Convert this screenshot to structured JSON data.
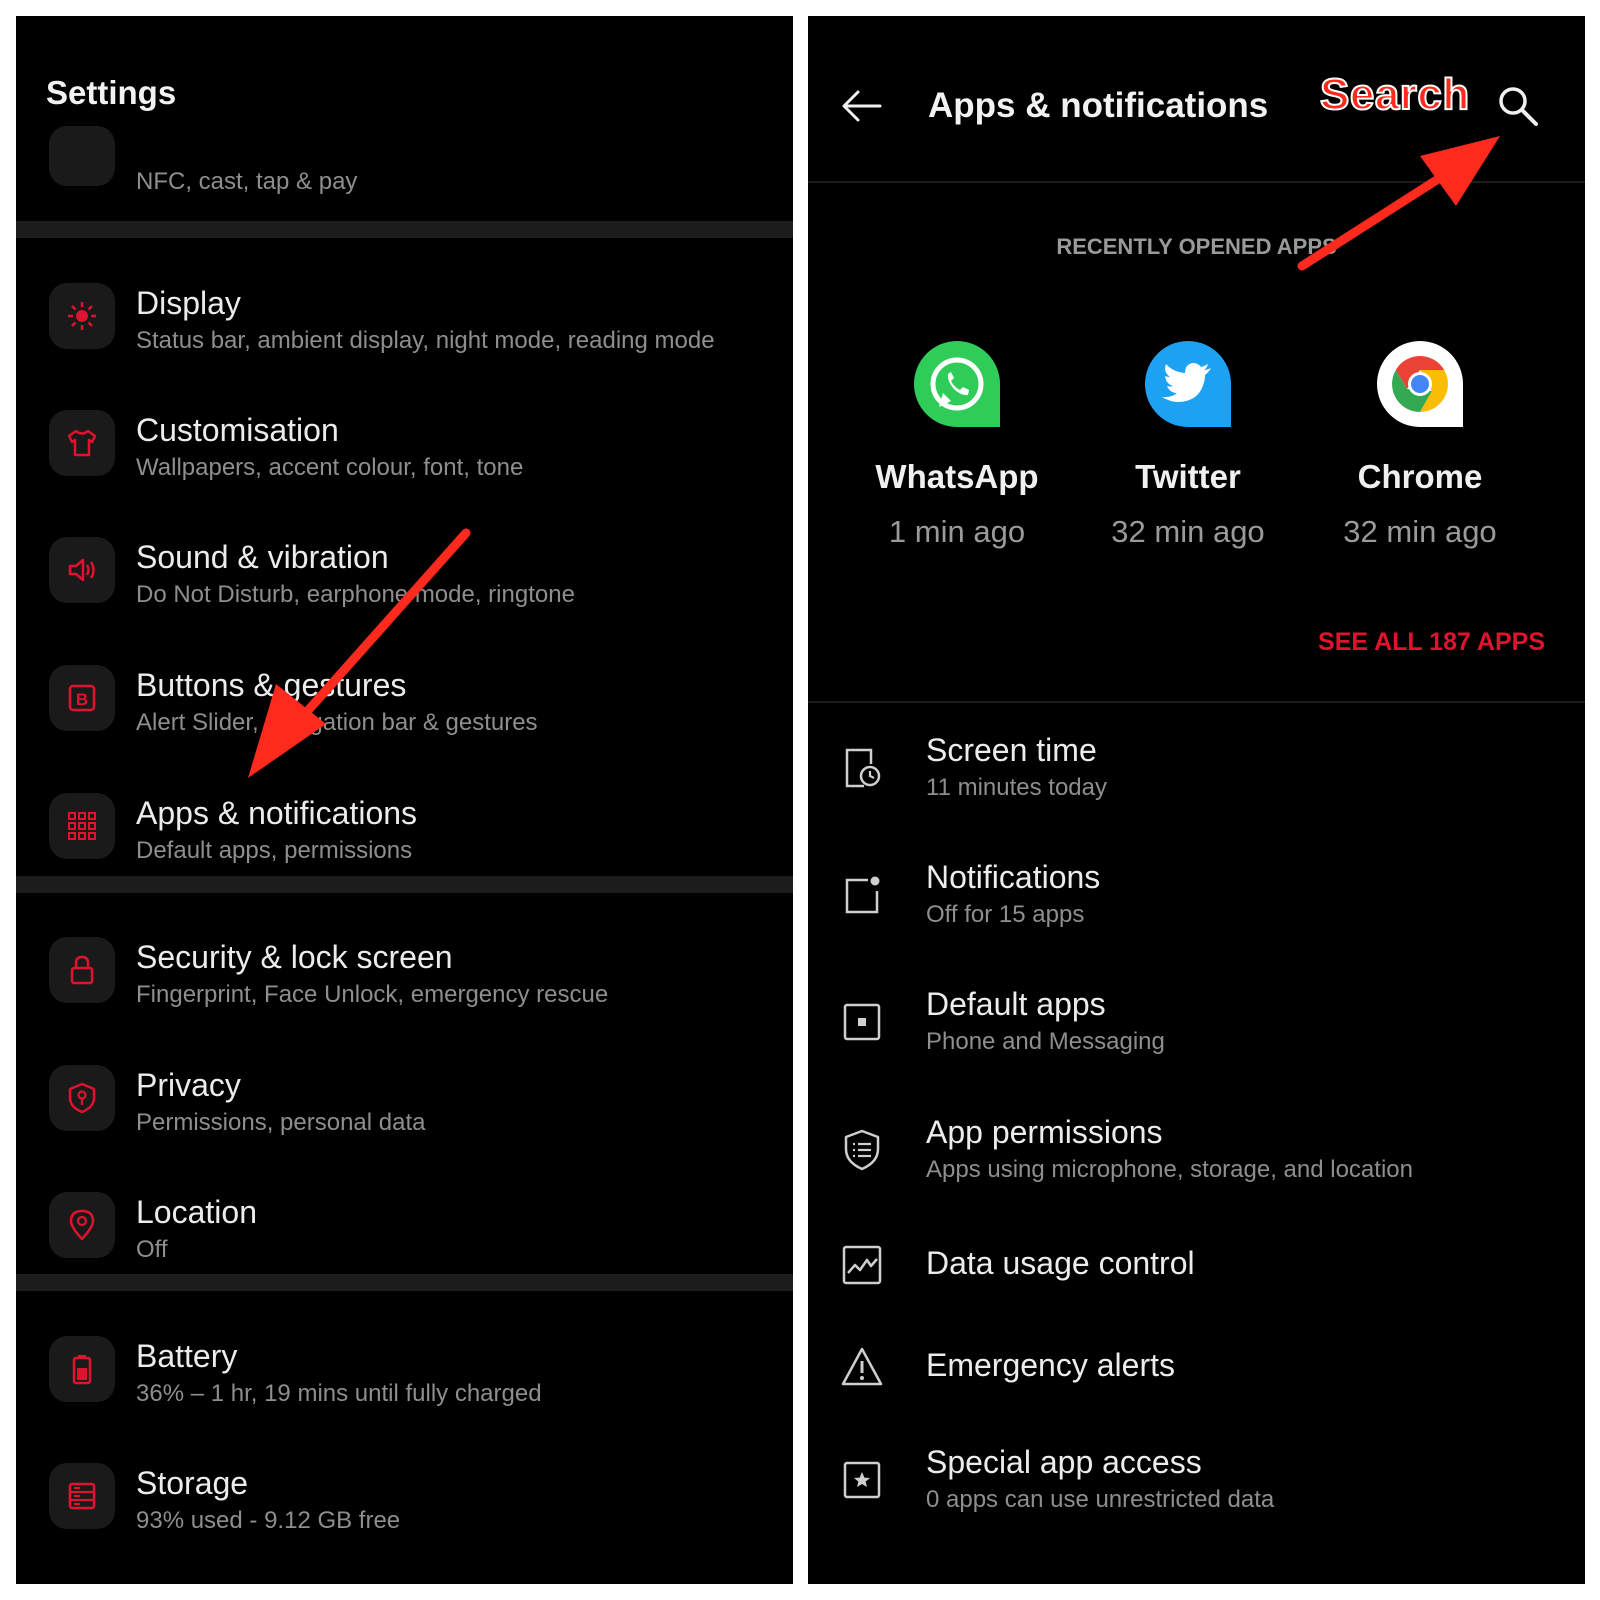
{
  "left": {
    "title": "Settings",
    "partial_item": {
      "subtitle": "NFC, cast, tap & pay"
    },
    "items": [
      {
        "title": "Display",
        "subtitle": "Status bar, ambient display, night mode, reading mode",
        "icon": "brightness-icon"
      },
      {
        "title": "Customisation",
        "subtitle": "Wallpapers, accent colour, font, tone",
        "icon": "shirt-icon"
      },
      {
        "title": "Sound & vibration",
        "subtitle": "Do Not Disturb, earphone mode, ringtone",
        "icon": "speaker-icon"
      },
      {
        "title": "Buttons & gestures",
        "subtitle": "Alert Slider, navigation bar & gestures",
        "icon": "b-button-icon"
      },
      {
        "title": "Apps & notifications",
        "subtitle": "Default apps, permissions",
        "icon": "apps-grid-icon"
      },
      {
        "title": "Security & lock screen",
        "subtitle": "Fingerprint, Face Unlock, emergency rescue",
        "icon": "lock-icon"
      },
      {
        "title": "Privacy",
        "subtitle": "Permissions, personal data",
        "icon": "shield-key-icon"
      },
      {
        "title": "Location",
        "subtitle": "Off",
        "icon": "location-pin-icon"
      },
      {
        "title": "Battery",
        "subtitle": "36% – 1 hr, 19 mins until fully charged",
        "icon": "battery-icon"
      },
      {
        "title": "Storage",
        "subtitle": "93% used - 9.12 GB free",
        "icon": "storage-icon"
      }
    ]
  },
  "right": {
    "header": {
      "title": "Apps & notifications",
      "annotation": "Search"
    },
    "recent_label": "RECENTLY OPENED APPS",
    "apps": [
      {
        "name": "WhatsApp",
        "time": "1 min ago",
        "icon": "whatsapp-icon"
      },
      {
        "name": "Twitter",
        "time": "32 min ago",
        "icon": "twitter-icon"
      },
      {
        "name": "Chrome",
        "time": "32 min ago",
        "icon": "chrome-icon"
      }
    ],
    "see_all": "SEE ALL 187 APPS",
    "items": [
      {
        "title": "Screen time",
        "subtitle": "11 minutes today",
        "icon": "screen-time-icon"
      },
      {
        "title": "Notifications",
        "subtitle": "Off for 15 apps",
        "icon": "notification-dot-icon"
      },
      {
        "title": "Default apps",
        "subtitle": "Phone and Messaging",
        "icon": "default-apps-icon"
      },
      {
        "title": "App permissions",
        "subtitle": "Apps using microphone, storage, and location",
        "icon": "permissions-shield-icon"
      },
      {
        "title": "Data usage control",
        "subtitle": "",
        "icon": "data-usage-icon"
      },
      {
        "title": "Emergency alerts",
        "subtitle": "",
        "icon": "warning-icon"
      },
      {
        "title": "Special app access",
        "subtitle": "0 apps can use unrestricted data",
        "icon": "star-box-icon"
      }
    ]
  },
  "colors": {
    "accent": "#e0122e",
    "background": "#000000",
    "annotation": "#ff2a1e"
  }
}
